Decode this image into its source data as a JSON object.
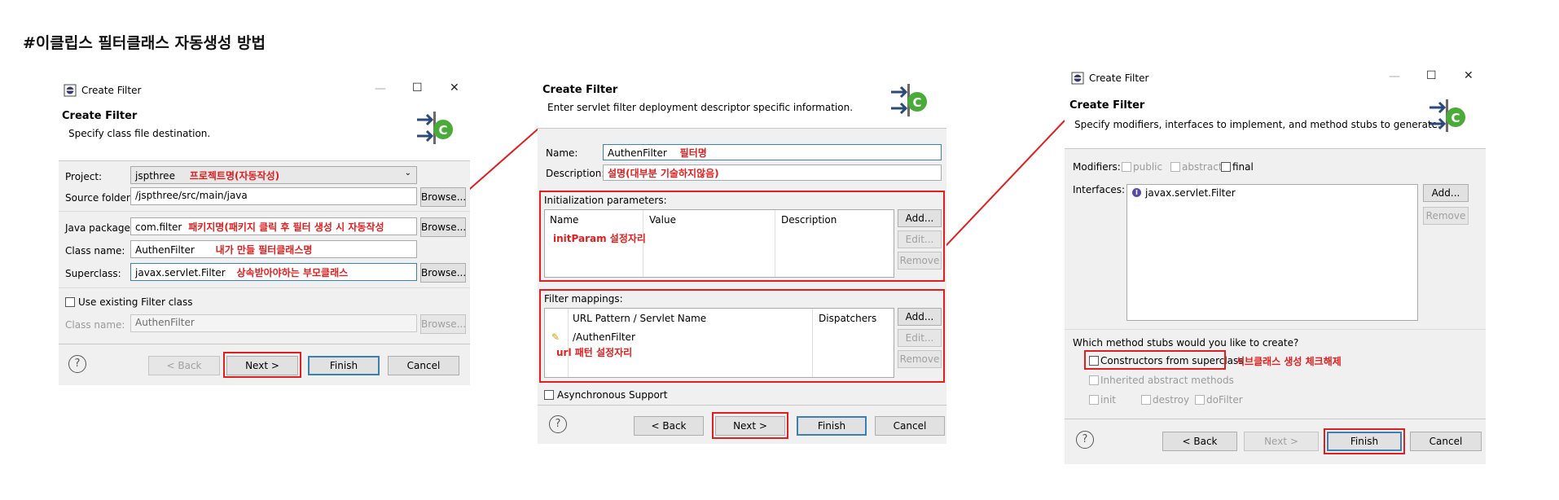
{
  "page_title": "#이클립스 필터클래스 자동생성 방법",
  "common": {
    "dialog_title": "Create Filter",
    "back": "< Back",
    "next": "Next >",
    "finish": "Finish",
    "cancel": "Cancel",
    "add": "Add...",
    "edit": "Edit...",
    "remove": "Remove",
    "browse": "Browse...",
    "help": "?"
  },
  "dialog1": {
    "window_title": "Create Filter",
    "subtitle": "Specify class file destination.",
    "project_label": "Project:",
    "project_value": "jspthree",
    "project_note": "프로젝트명(자동작성)",
    "source_label": "Source folder:",
    "source_value": "/jspthree/src/main/java",
    "package_label": "Java package:",
    "package_value": "com.filter",
    "package_note": "패키지명(패키지 클릭 후 필터 생성 시 자동작성",
    "classname_label": "Class name:",
    "classname_value": "AuthenFilter",
    "classname_note": "내가 만들 필터클래스명",
    "superclass_label": "Superclass:",
    "superclass_value": "javax.servlet.Filter",
    "superclass_note": "상속받아야하는 부모클래스",
    "use_existing_label": "Use existing Filter class",
    "classname2_label": "Class name:",
    "classname2_value": "AuthenFilter"
  },
  "dialog2": {
    "subtitle": "Enter servlet filter deployment descriptor specific information.",
    "name_label": "Name:",
    "name_value": "AuthenFilter",
    "name_note": "필터명",
    "description_label": "Description:",
    "description_note": "설명(대부분 기술하지않음)",
    "init_params_label": "Initialization parameters:",
    "init_columns": [
      "Name",
      "Value",
      "Description"
    ],
    "init_note": "initParam 설정자리",
    "mappings_label": "Filter mappings:",
    "mapping_columns": [
      "URL Pattern / Servlet Name",
      "Dispatchers"
    ],
    "mapping_row": "/AuthenFilter",
    "mapping_note": "url 패턴 설정자리",
    "async_label": "Asynchronous Support"
  },
  "dialog3": {
    "window_title": "Create Filter",
    "subtitle": "Specify modifiers, interfaces to implement, and method stubs to generate.",
    "modifiers_label": "Modifiers:",
    "mod_public": "public",
    "mod_abstract": "abstract",
    "mod_final": "final",
    "interfaces_label": "Interfaces:",
    "interface_item": "javax.servlet.Filter",
    "stubs_question": "Which method stubs would you like to create?",
    "constructors_label": "Constructors from superclass",
    "constructors_note": "서브클래스 생성 체크해제",
    "inherited_label": "Inherited abstract methods",
    "stub_init": "init",
    "stub_destroy": "destroy",
    "stub_dofilter": "doFilter"
  },
  "colors": {
    "annotation_red": "#e02020",
    "dialog_bg": "#f0f0f0",
    "default_button_border": "#3c7fb1"
  },
  "icons": [
    "eclipse-window-icon",
    "create-class-wizard-icon",
    "help-icon",
    "interface-icon",
    "mapping-icon",
    "minimize-icon",
    "maximize-icon",
    "close-icon"
  ]
}
